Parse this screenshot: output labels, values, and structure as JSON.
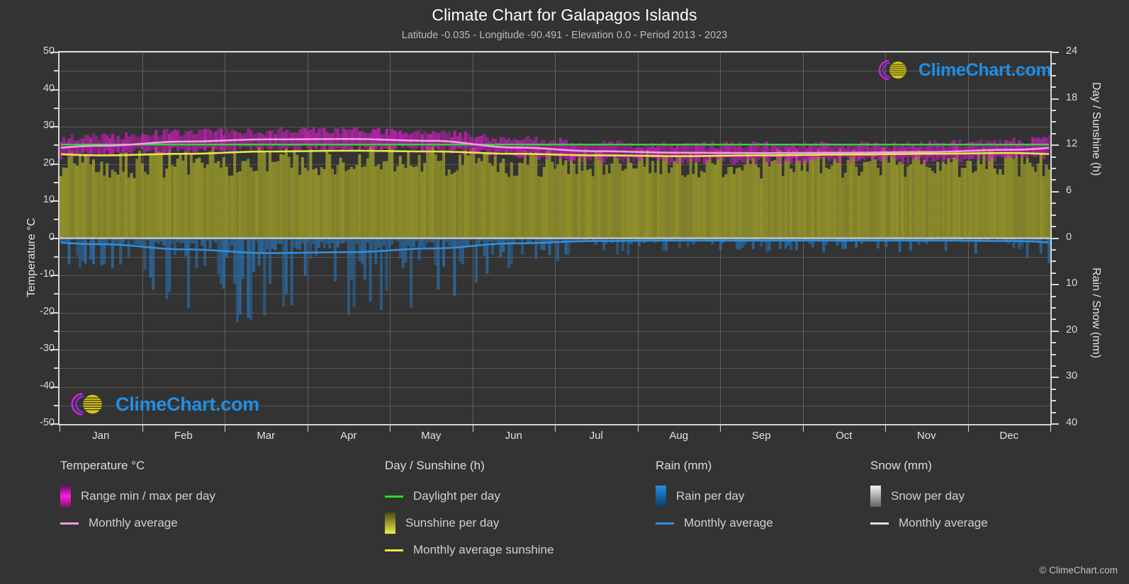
{
  "header": {
    "title": "Climate Chart for Galapagos Islands",
    "subtitle": "Latitude -0.035 - Longitude -90.491 - Elevation 0.0 - Period 2013 - 2023"
  },
  "axes": {
    "left_title": "Temperature °C",
    "right_title_upper": "Day / Sunshine (h)",
    "right_title_lower": "Rain / Snow (mm)",
    "left_ticks": [
      "50",
      "40",
      "30",
      "20",
      "10",
      "0",
      "-10",
      "-20",
      "-30",
      "-40",
      "-50"
    ],
    "right_ticks_upper": [
      "24",
      "18",
      "12",
      "6",
      "0"
    ],
    "right_ticks_lower": [
      "10",
      "20",
      "30",
      "40"
    ],
    "months": [
      "Jan",
      "Feb",
      "Mar",
      "Apr",
      "May",
      "Jun",
      "Jul",
      "Aug",
      "Sep",
      "Oct",
      "Nov",
      "Dec"
    ]
  },
  "legend": {
    "temperature": {
      "heading": "Temperature °C",
      "items": [
        {
          "label": "Range min / max per day",
          "marker": "range-swatch"
        },
        {
          "label": "Monthly average",
          "marker": "line-swatch"
        }
      ]
    },
    "daysunshine": {
      "heading": "Day / Sunshine (h)",
      "items": [
        {
          "label": "Daylight per day",
          "marker": "line-swatch"
        },
        {
          "label": "Sunshine per day",
          "marker": "range-swatch"
        },
        {
          "label": "Monthly average sunshine",
          "marker": "line-swatch"
        }
      ]
    },
    "rain": {
      "heading": "Rain (mm)",
      "items": [
        {
          "label": "Rain per day",
          "marker": "range-swatch"
        },
        {
          "label": "Monthly average",
          "marker": "line-swatch"
        }
      ]
    },
    "snow": {
      "heading": "Snow (mm)",
      "items": [
        {
          "label": "Snow per day",
          "marker": "range-swatch"
        },
        {
          "label": "Monthly average",
          "marker": "line-swatch"
        }
      ]
    }
  },
  "watermark": {
    "text": "ClimeChart.com"
  },
  "footer": {
    "copyright": "© ClimeChart.com"
  },
  "colors": {
    "background": "#333333",
    "temp_range": "#d122c6",
    "temp_avg_line": "#f19de0",
    "daylight_line": "#22e022",
    "sunshine_fill": "#8c8c2b",
    "sunshine_avg_line": "#e8e83c",
    "rain_fill": "#1c3a5c",
    "rain_avg_line": "#2f8fe0",
    "snow_fill": "#cfcfcf",
    "grid": "#565656",
    "axis": "#d6d6d6"
  },
  "chart_data": {
    "type": "line",
    "title": "Climate Chart for Galapagos Islands",
    "subtitle": "Latitude -0.035 - Longitude -90.491 - Elevation 0.0 - Period 2013 - 2023",
    "xlabel": "",
    "ylabel": "Temperature °C",
    "categories": [
      "Jan",
      "Feb",
      "Mar",
      "Apr",
      "May",
      "Jun",
      "Jul",
      "Aug",
      "Sep",
      "Oct",
      "Nov",
      "Dec"
    ],
    "ylim_temperature": [
      -50,
      50
    ],
    "ylim_day_sunshine": [
      0,
      24
    ],
    "ylim_rain_snow": [
      0,
      40
    ],
    "grid": true,
    "legend_position": "below",
    "series": [
      {
        "name": "Monthly average temperature",
        "unit": "°C",
        "axis": "temperature",
        "color": "#f19de0",
        "values": [
          24.9,
          26.0,
          26.6,
          26.7,
          26.2,
          24.4,
          23.4,
          23.0,
          22.9,
          23.0,
          23.2,
          23.8
        ]
      },
      {
        "name": "Range max per day (temperature)",
        "unit": "°C",
        "axis": "temperature",
        "color": "#d122c6",
        "values": [
          27.0,
          28.2,
          28.6,
          28.7,
          28.0,
          26.3,
          25.2,
          24.8,
          24.7,
          24.8,
          25.0,
          25.7
        ]
      },
      {
        "name": "Range min per day (temperature)",
        "unit": "°C",
        "axis": "temperature",
        "color": "#d122c6",
        "values": [
          23.1,
          24.0,
          24.6,
          24.7,
          24.3,
          22.6,
          21.7,
          21.3,
          21.2,
          21.3,
          21.5,
          22.0
        ]
      },
      {
        "name": "Daylight per day",
        "unit": "h",
        "axis": "day_sunshine",
        "color": "#22e022",
        "values": [
          12.1,
          12.1,
          12.1,
          12.1,
          12.1,
          12.1,
          12.1,
          12.1,
          12.1,
          12.1,
          12.1,
          12.1
        ]
      },
      {
        "name": "Monthly average sunshine",
        "unit": "h",
        "axis": "day_sunshine",
        "color": "#e8e83c",
        "values": [
          10.7,
          10.9,
          11.2,
          11.3,
          11.2,
          10.9,
          10.7,
          10.6,
          10.7,
          10.8,
          10.9,
          11.0
        ]
      },
      {
        "name": "Monthly average rain",
        "unit": "mm",
        "axis": "rain_snow",
        "color": "#2f8fe0",
        "values": [
          1.3,
          2.4,
          3.2,
          3.0,
          2.2,
          1.1,
          0.6,
          0.5,
          0.5,
          0.5,
          0.5,
          0.6
        ]
      },
      {
        "name": "Monthly average snow",
        "unit": "mm",
        "axis": "rain_snow",
        "color": "#e0e0e0",
        "values": [
          0,
          0,
          0,
          0,
          0,
          0,
          0,
          0,
          0,
          0,
          0,
          0
        ]
      }
    ]
  }
}
